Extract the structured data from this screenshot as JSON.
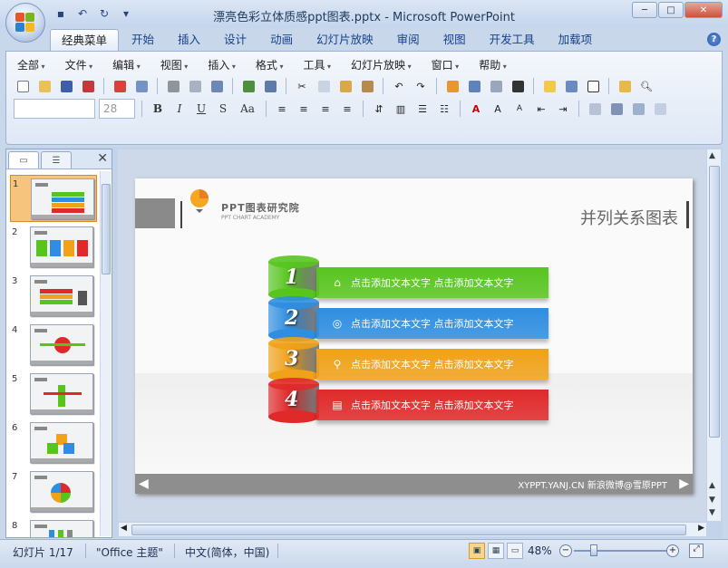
{
  "window": {
    "title": "漂亮色彩立体质感ppt图表.pptx - Microsoft PowerPoint",
    "controls": [
      "─",
      "□",
      "✕"
    ]
  },
  "qat": {
    "icons": [
      "save-icon",
      "undo-icon",
      "redo-icon",
      "customize-icon"
    ]
  },
  "tabs": [
    "经典菜单",
    "开始",
    "插入",
    "设计",
    "动画",
    "幻灯片放映",
    "审阅",
    "视图",
    "开发工具",
    "加载项"
  ],
  "menu": [
    "全部",
    "文件",
    "编辑",
    "视图",
    "插入",
    "格式",
    "工具",
    "幻灯片放映",
    "窗口",
    "帮助"
  ],
  "format": {
    "font_name": "",
    "font_size": "28",
    "bold": "B",
    "italic": "I",
    "underline": "U",
    "shadow": "S",
    "case": "Aa"
  },
  "thumbnails": [
    "1",
    "2",
    "3",
    "4",
    "5",
    "6",
    "7",
    "8"
  ],
  "slide": {
    "brand": "PPT图表研究院",
    "brand_sub": "PPT CHART ACADEMY",
    "title": "并列关系图表",
    "footer": "XYPPT.YANJ.CN 新浪微博@雪原PPT",
    "items": [
      {
        "num": "1",
        "text": "点击添加文本文字 点击添加文本文字",
        "icon": "home-icon",
        "color": "#58c51f"
      },
      {
        "num": "2",
        "text": "点击添加文本文字 点击添加文本文字",
        "icon": "globe-icon",
        "color": "#2f8ee0"
      },
      {
        "num": "3",
        "text": "点击添加文本文字 点击添加文本文字",
        "icon": "search-icon",
        "color": "#f0a21a"
      },
      {
        "num": "4",
        "text": "点击添加文本文字 点击添加文本文字",
        "icon": "chart-icon",
        "color": "#e02a2a"
      }
    ]
  },
  "status": {
    "slide": "幻灯片 1/17",
    "theme": "\"Office 主题\"",
    "language": "中文(简体，中国)",
    "zoom": "48%"
  }
}
